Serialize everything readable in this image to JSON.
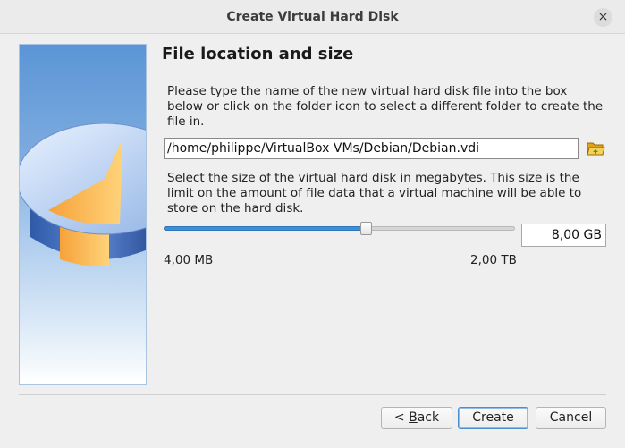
{
  "window": {
    "title": "Create Virtual Hard Disk",
    "close_glyph": "×"
  },
  "page": {
    "heading": "File location and size",
    "location_description": "Please type the name of the new virtual hard disk file into the box below or click on the folder icon to select a different folder to create the file in.",
    "file_path": "/home/philippe/VirtualBox VMs/Debian/Debian.vdi",
    "folder_icon": "folder-open-icon",
    "size_description": "Select the size of the virtual hard disk in megabytes. This size is the limit on the amount of file data that a virtual machine will be able to store on the hard disk.",
    "size_value": "8,00 GB",
    "slider_position_fraction": 0.574,
    "min_label": "4,00 MB",
    "max_label": "2,00 TB"
  },
  "buttons": {
    "back_mnemonic": "B",
    "back_rest": "ack",
    "back_prefix": "< ",
    "create": "Create",
    "cancel": "Cancel"
  },
  "colors": {
    "accent": "#3d8fd6"
  }
}
